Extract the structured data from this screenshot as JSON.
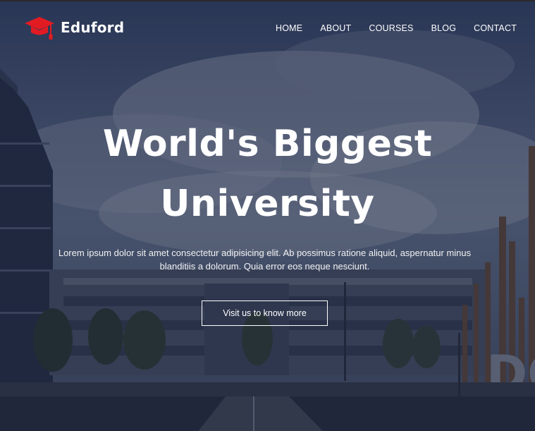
{
  "brand": {
    "name": "Eduford",
    "logo_icon": "graduation-cap-icon",
    "accent_color": "#e21b23"
  },
  "nav": {
    "items": [
      {
        "label": "HOME"
      },
      {
        "label": "ABOUT"
      },
      {
        "label": "COURSES"
      },
      {
        "label": "BLOG"
      },
      {
        "label": "CONTACT"
      }
    ]
  },
  "hero": {
    "title_line1": "World's Biggest",
    "title_line2": "University",
    "description": "Lorem ipsum dolor sit amet consectetur adipisicing elit. Ab possimus ratione aliquid, aspernatur minus blanditiis a dolorum. Quia error eos neque nesciunt.",
    "cta_label": "Visit us to know more"
  }
}
